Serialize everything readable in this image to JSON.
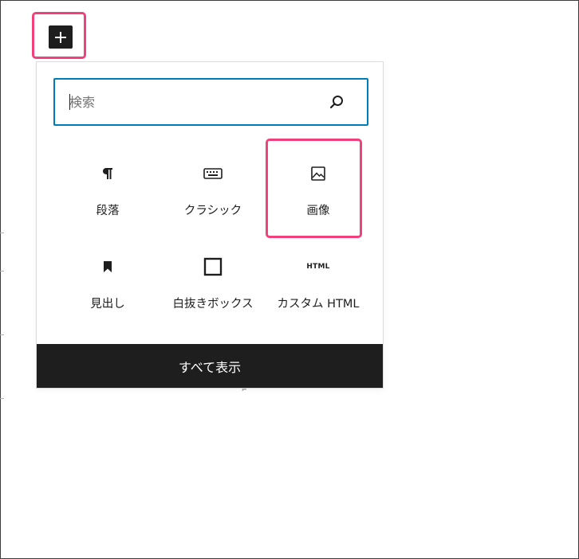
{
  "toolbar": {
    "add_block_icon": "plus-icon"
  },
  "inserter": {
    "search": {
      "placeholder": "検索",
      "value": "",
      "icon": "search-icon"
    },
    "blocks": [
      {
        "label": "段落",
        "icon": "paragraph-icon"
      },
      {
        "label": "クラシック",
        "icon": "keyboard-icon"
      },
      {
        "label": "画像",
        "icon": "image-icon"
      },
      {
        "label": "見出し",
        "icon": "bookmark-icon"
      },
      {
        "label": "白抜きボックス",
        "icon": "square-icon"
      },
      {
        "label": "カスタム HTML",
        "icon": "html-icon",
        "icon_text": "HTML"
      }
    ],
    "show_all_label": "すべて表示"
  },
  "colors": {
    "highlight": "#f0417a",
    "accent": "#007cba",
    "dark": "#1e1e1e"
  }
}
